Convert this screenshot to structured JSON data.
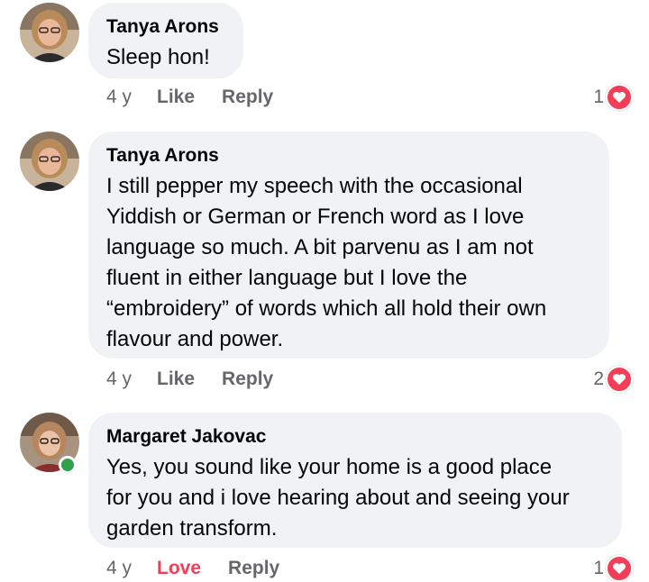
{
  "comments": [
    {
      "author": "Tanya Arons",
      "text": "Sleep hon!",
      "time": "4 y",
      "like_label": "Like",
      "reply_label": "Reply",
      "reaction_count": "1",
      "reaction_icon": "heart-icon",
      "online": false
    },
    {
      "author": "Tanya Arons",
      "text": "I still pepper my speech with the occasional\nYiddish or German or French word as I love\nlanguage so much.  A bit parvenu as I am not\nfluent in either language but I love the\n“embroidery” of words which all hold their own\nflavour and power.",
      "time": "4 y",
      "like_label": "Like",
      "reply_label": "Reply",
      "reaction_count": "2",
      "reaction_icon": "heart-icon",
      "online": false
    },
    {
      "author": "Margaret Jakovac",
      "text": "Yes, you sound like your home is a good place\nfor you and i love hearing about and seeing your\ngarden transform.",
      "time": "4 y",
      "like_label": "Love",
      "reply_label": "Reply",
      "reaction_count": "1",
      "reaction_icon": "heart-icon",
      "online": true
    }
  ],
  "colors": {
    "bubble_bg": "#f0f2f5",
    "secondary_text": "#65676b",
    "love_red": "#f33e58",
    "online_green": "#31a24c"
  }
}
